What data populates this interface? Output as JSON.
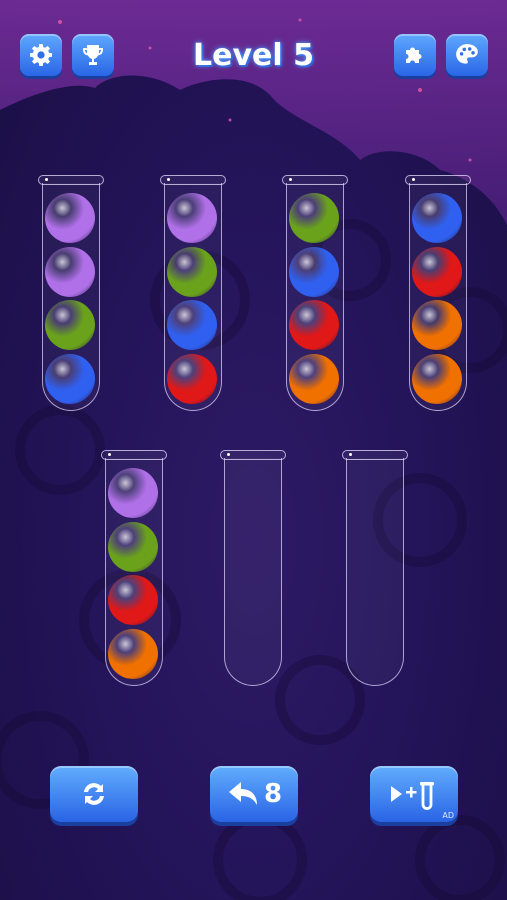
{
  "header": {
    "title": "Level 5",
    "settings_icon": "gear-icon",
    "trophy_icon": "trophy-icon",
    "puzzle_icon": "puzzle-icon",
    "theme_icon": "palette-icon"
  },
  "colors": {
    "purple": "#b070e8",
    "green": "#6aa21c",
    "blue": "#3060f0",
    "red": "#e01818",
    "orange": "#f07000",
    "button": "#2a66e6",
    "background": "#24145a"
  },
  "tubes": [
    {
      "balls": [
        "purple",
        "purple",
        "green",
        "blue"
      ]
    },
    {
      "balls": [
        "purple",
        "green",
        "blue",
        "red"
      ]
    },
    {
      "balls": [
        "green",
        "blue",
        "red",
        "orange"
      ]
    },
    {
      "balls": [
        "blue",
        "red",
        "orange",
        "orange"
      ]
    },
    {
      "balls": [
        "purple",
        "green",
        "red",
        "orange"
      ]
    },
    {
      "balls": []
    },
    {
      "balls": []
    }
  ],
  "controls": {
    "restart_icon": "restart-icon",
    "undo_icon": "undo-icon",
    "undo_count": "8",
    "add_tube_icon": "add-tube-icon",
    "ad_label": "AD"
  }
}
